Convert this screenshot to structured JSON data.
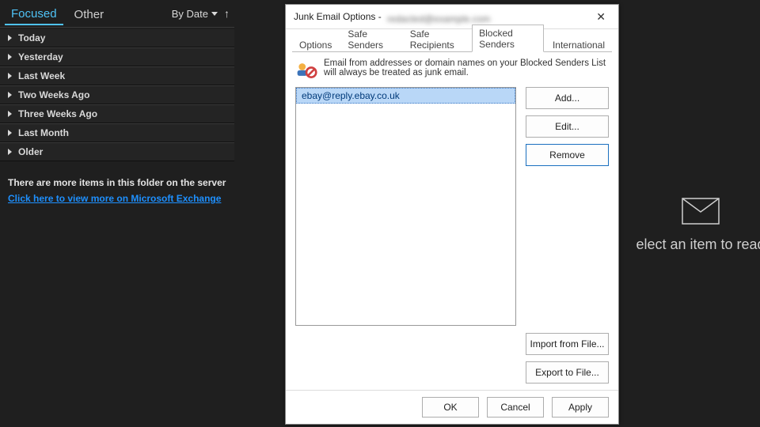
{
  "left_panel": {
    "tabs": {
      "focused": "Focused",
      "other": "Other"
    },
    "sort": {
      "label": "By Date"
    },
    "groups": [
      "Today",
      "Yesterday",
      "Last Week",
      "Two Weeks Ago",
      "Three Weeks Ago",
      "Last Month",
      "Older"
    ],
    "more_note": "There are more items in this folder on the server",
    "more_link": "Click here to view more on Microsoft Exchange"
  },
  "reading_pane": {
    "placeholder": "elect an item to read"
  },
  "dialog": {
    "title_prefix": "Junk Email Options - ",
    "title_obscured": "redacted@example.com",
    "tabs": [
      "Options",
      "Safe Senders",
      "Safe Recipients",
      "Blocked Senders",
      "International"
    ],
    "active_tab_index": 3,
    "description": "Email from addresses or domain names on your Blocked Senders List will always be treated as junk email.",
    "list": [
      "ebay@reply.ebay.co.uk"
    ],
    "buttons": {
      "add": "Add...",
      "edit": "Edit...",
      "remove": "Remove",
      "import": "Import from File...",
      "export": "Export to File..."
    },
    "bottom": {
      "ok": "OK",
      "cancel": "Cancel",
      "apply": "Apply"
    }
  }
}
